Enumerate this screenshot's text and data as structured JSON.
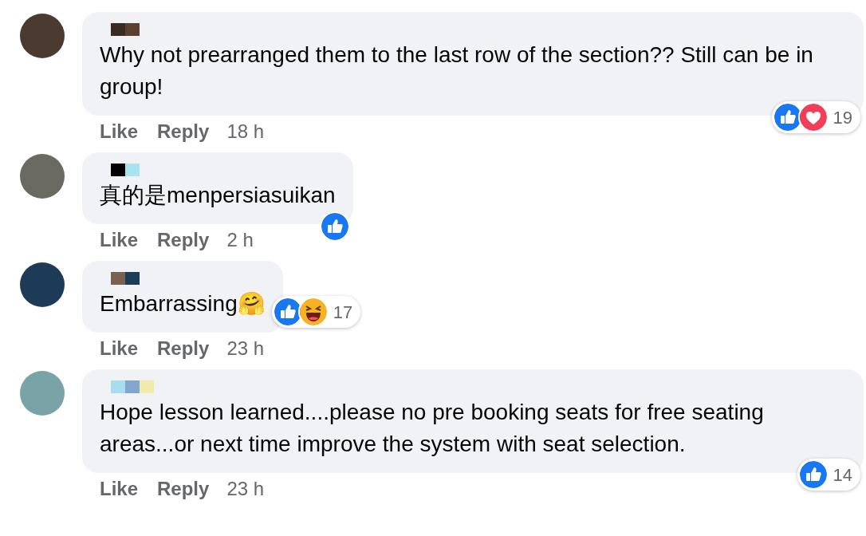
{
  "comments": [
    {
      "text": "Why not prearranged them to the last row of the section?? Still can be in group!",
      "reactions": [
        {
          "kind": "like"
        },
        {
          "kind": "love"
        }
      ],
      "reaction_count": "19",
      "actions": [
        "Like",
        "Reply"
      ],
      "time": "18 h"
    },
    {
      "text": "真的是menpersiasuikan",
      "reactions": [
        {
          "kind": "like"
        }
      ],
      "actions": [
        "Like",
        "Reply"
      ],
      "time": "2 h"
    },
    {
      "text": "Embarrassing🤗",
      "reactions": [
        {
          "kind": "like"
        },
        {
          "kind": "haha"
        }
      ],
      "reaction_count": "17",
      "actions": [
        "Like",
        "Reply"
      ],
      "time": "23 h"
    },
    {
      "text": "Hope lesson learned....please no pre booking seats for free seating areas...or next time improve the system with seat selection.",
      "reactions": [
        {
          "kind": "like"
        }
      ],
      "reaction_count": "14",
      "actions": [
        "Like",
        "Reply"
      ],
      "time": "23 h"
    }
  ]
}
